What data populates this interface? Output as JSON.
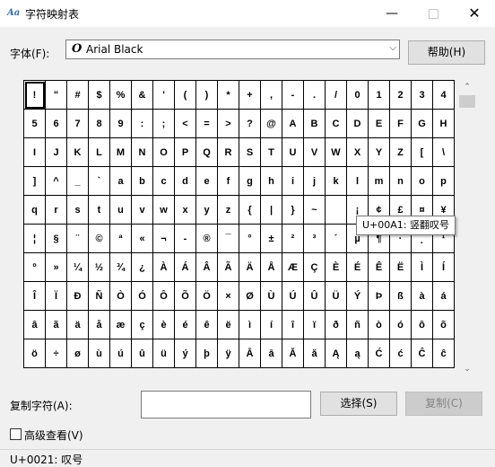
{
  "window": {
    "title": "字符映射表",
    "min_glyph": "—",
    "close_glyph": "✕"
  },
  "font_row": {
    "label": "字体(F):",
    "font_icon": "O",
    "selected_font": "Arial Black",
    "chevron": "⌵",
    "help_button": "帮助(H)"
  },
  "grid": {
    "rows": [
      [
        "!",
        "\"",
        "#",
        "$",
        "%",
        "&",
        "'",
        "(",
        ")",
        "*",
        "+",
        ",",
        "-",
        ".",
        "/",
        "0",
        "1",
        "2",
        "3",
        "4"
      ],
      [
        "5",
        "6",
        "7",
        "8",
        "9",
        ":",
        ";",
        "<",
        "=",
        ">",
        "?",
        "@",
        "A",
        "B",
        "C",
        "D",
        "E",
        "F",
        "G",
        "H"
      ],
      [
        "I",
        "J",
        "K",
        "L",
        "M",
        "N",
        "O",
        "P",
        "Q",
        "R",
        "S",
        "T",
        "U",
        "V",
        "W",
        "X",
        "Y",
        "Z",
        "[",
        "\\"
      ],
      [
        "]",
        "^",
        "_",
        "`",
        "a",
        "b",
        "c",
        "d",
        "e",
        "f",
        "g",
        "h",
        "i",
        "j",
        "k",
        "l",
        "m",
        "n",
        "o",
        "p"
      ],
      [
        "q",
        "r",
        "s",
        "t",
        "u",
        "v",
        "w",
        "x",
        "y",
        "z",
        "{",
        "|",
        "}",
        "~",
        " ",
        "¡",
        "¢",
        "£",
        "¤",
        "¥"
      ],
      [
        "¦",
        "§",
        "¨",
        "©",
        "ª",
        "«",
        "¬",
        "-",
        "®",
        "¯",
        "°",
        "±",
        "²",
        "³",
        "´",
        "µ",
        "¶",
        "·",
        "¸",
        "¹"
      ],
      [
        "º",
        "»",
        "¼",
        "½",
        "¾",
        "¿",
        "À",
        "Á",
        "Â",
        "Ã",
        "Ä",
        "Å",
        "Æ",
        "Ç",
        "È",
        "É",
        "Ê",
        "Ë",
        "Ì",
        "Í"
      ],
      [
        "Î",
        "Ï",
        "Ð",
        "Ñ",
        "Ò",
        "Ó",
        "Ô",
        "Õ",
        "Ö",
        "×",
        "Ø",
        "Ù",
        "Ú",
        "Û",
        "Ü",
        "Ý",
        "Þ",
        "ß",
        "à",
        "á"
      ],
      [
        "â",
        "ã",
        "ä",
        "å",
        "æ",
        "ç",
        "è",
        "é",
        "ê",
        "ë",
        "ì",
        "í",
        "î",
        "ï",
        "ð",
        "ñ",
        "ò",
        "ó",
        "ô",
        "õ"
      ],
      [
        "ö",
        "÷",
        "ø",
        "ù",
        "ú",
        "û",
        "ü",
        "ý",
        "þ",
        "ÿ",
        "Ā",
        "ā",
        "Ă",
        "ă",
        "Ą",
        "ą",
        "Ć",
        "ć",
        "Ĉ",
        "ĉ"
      ]
    ]
  },
  "scroll": {
    "up": "⌃",
    "down": "⌄"
  },
  "tooltip": "U+00A1: 竖翻叹号",
  "copy_row": {
    "label": "复制字符(A):",
    "value": "",
    "select_button": "选择(S)",
    "copy_button": "复制(C)"
  },
  "advanced": {
    "label": "高级查看(V)",
    "checked": false
  },
  "status": "U+0021: 叹号"
}
